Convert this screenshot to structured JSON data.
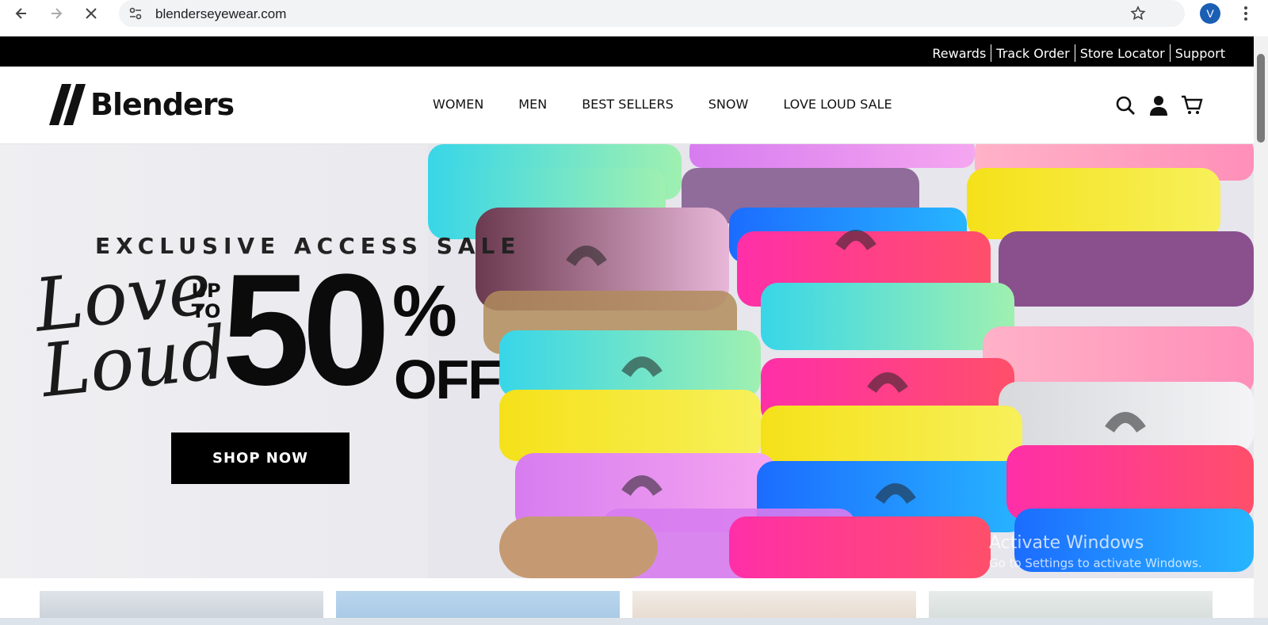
{
  "browser": {
    "url": "blenderseyewear.com",
    "profile_initial": "V",
    "icons": [
      "back-arrow-icon",
      "forward-arrow-icon",
      "close-icon",
      "site-settings-icon",
      "bookmark-star-icon",
      "more-vert-icon"
    ]
  },
  "topbar": {
    "links": [
      "Rewards",
      "Track Order",
      "Store Locator",
      "Support"
    ]
  },
  "header": {
    "logo_text": "Blenders",
    "nav": [
      "WOMEN",
      "MEN",
      "BEST SELLERS",
      "SNOW",
      "LOVE LOUD SALE"
    ],
    "icons": [
      "search-icon",
      "account-icon",
      "cart-icon"
    ]
  },
  "hero": {
    "kicker": "EXCLUSIVE ACCESS SALE",
    "script_line1": "Love",
    "script_line2": "Loud.",
    "up": "UP",
    "to": "TO",
    "big_number": "50",
    "percent": "%",
    "off": "OFF",
    "cta": "SHOP NOW"
  },
  "watermark": {
    "title": "Activate Windows",
    "subtitle": "Go to Settings to activate Windows."
  },
  "colors": {
    "black": "#000000",
    "chrome_bg": "#f1f3f4",
    "avatar": "#1a5fb4"
  }
}
